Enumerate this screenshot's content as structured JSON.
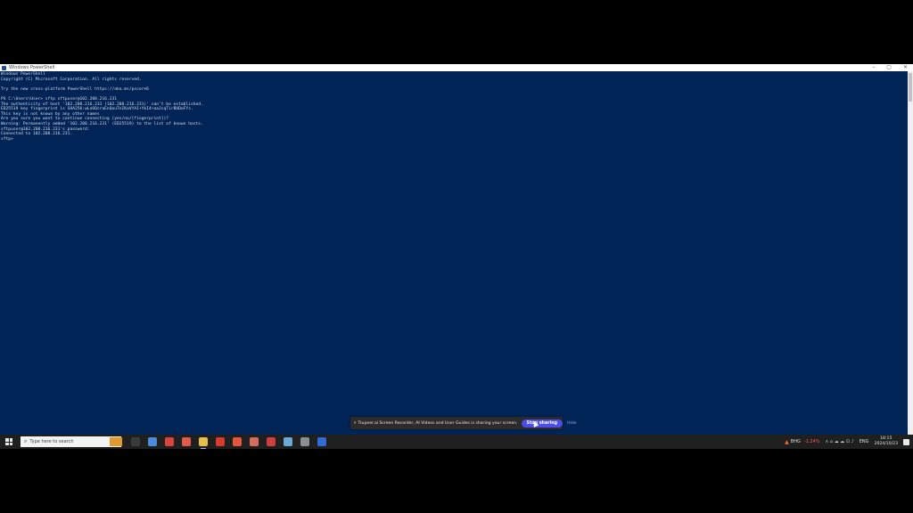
{
  "window": {
    "title": "Windows PowerShell",
    "controls": {
      "minimize": "–",
      "maximize": "▢",
      "close": "✕"
    }
  },
  "console": {
    "lines": [
      "Windows PowerShell",
      "Copyright (C) Microsoft Corporation. All rights reserved.",
      "",
      "Try the new cross-platform PowerShell https://aka.ms/pscore6",
      "",
      "PS C:\\Users\\User> sftp sftpuser@102.208.216.231",
      "The authenticity of host '102.208.216.231 (102.208.216.231)' can't be established.",
      "ED25519 key fingerprint is SHA256:wLnOQcraEnQouTnIKaVYAI+YkI4+aaJcqTirBUDoFYs.",
      "This key is not known by any other names",
      "Are you sure you want to continue connecting (yes/no/[fingerprint])?",
      "Warning: Permanently added '102.208.216.231' (ED25519) to the list of known hosts.",
      "sftpuser@102.208.216.231's password:",
      "Connected to 102.208.216.231.",
      "sftp>"
    ]
  },
  "share_bar": {
    "message": "Trupeer.ai Screen Recorder, AI Videos and User Guides is sharing your screen.",
    "stop_label": "Stop sharing",
    "hide_label": "Hide"
  },
  "taskbar": {
    "search_placeholder": "Type here to search",
    "apps": [
      {
        "name": "task-view",
        "color": "#3a3a3a"
      },
      {
        "name": "chrome",
        "color": "#4a8ad8"
      },
      {
        "name": "app-red",
        "color": "#d9453b"
      },
      {
        "name": "chrome-profile",
        "color": "#e05a4e"
      },
      {
        "name": "file-explorer",
        "color": "#e7c04a"
      },
      {
        "name": "pdf-reader",
        "color": "#d83b2f"
      },
      {
        "name": "app-orange",
        "color": "#e4573d"
      },
      {
        "name": "app-coral",
        "color": "#d66b5f"
      },
      {
        "name": "app-red-2",
        "color": "#cf3f3f"
      },
      {
        "name": "cloud-app",
        "color": "#6aa9d8"
      },
      {
        "name": "photos",
        "color": "#8a8f96"
      },
      {
        "name": "powershell",
        "color": "#2f6bd6"
      }
    ],
    "stock_name": "BHG",
    "stock_change": "-1.24%",
    "system_icons": "∧ ⌂ ☁ ☁ ⊡ ♪",
    "language": "ENG",
    "time": "18:15",
    "date": "2024/10/23"
  }
}
